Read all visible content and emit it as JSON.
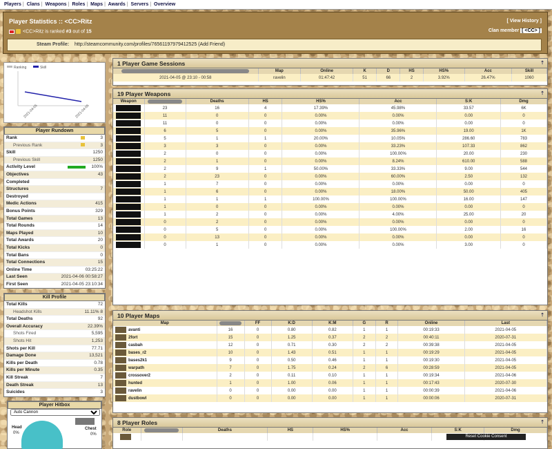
{
  "nav": [
    "Players",
    "Clans",
    "Weapons",
    "Roles",
    "Maps",
    "Awards",
    "Servers",
    "Overview"
  ],
  "header": {
    "title": "Player Statistics :: <CC>Ritz",
    "subtitle_name": "<CC>Ritz is ranked",
    "rank_num": "#3",
    "rank_of": "out of",
    "rank_total": "15",
    "view_history": "[ View History ]",
    "clan_label": "Clan member",
    "clan_tag": "[ <CC> ]",
    "steam_label": "Steam Profile:",
    "steam_url": "http://steamcommunity.com/profiles/76561197979412525 (Add Friend)"
  },
  "graph": {
    "legend": [
      "Ranking",
      "Skill"
    ],
    "dates": [
      "2021-04-05",
      "2021-04-06"
    ]
  },
  "rundown": {
    "title": "Player Rundown",
    "rows": [
      {
        "k": "Rank",
        "v": "3",
        "sub": false,
        "icon": true
      },
      {
        "k": "Previous Rank",
        "v": "3",
        "sub": true,
        "icon": true
      },
      {
        "k": "Skill",
        "v": "1250",
        "sub": false
      },
      {
        "k": "Previous Skill",
        "v": "1250",
        "sub": true
      },
      {
        "k": "Activity Level",
        "v": "100%",
        "sub": false,
        "bar": true
      },
      {
        "k": "Objectives",
        "v": "43",
        "sub": false
      },
      {
        "k": "Completed",
        "v": "",
        "sub": false
      },
      {
        "k": "Structures",
        "v": "7",
        "sub": false
      },
      {
        "k": "Destroyed",
        "v": "",
        "sub": false
      },
      {
        "k": "Medic Actions",
        "v": "415",
        "sub": false
      },
      {
        "k": "Bonus Points",
        "v": "329",
        "sub": false
      },
      {
        "k": "Total Games",
        "v": "13",
        "sub": false
      },
      {
        "k": "Total Rounds",
        "v": "14",
        "sub": false
      },
      {
        "k": "Maps Played",
        "v": "10",
        "sub": false
      },
      {
        "k": "Total Awards",
        "v": "20",
        "sub": false
      },
      {
        "k": "Total Kicks",
        "v": "0",
        "sub": false
      },
      {
        "k": "Total Bans",
        "v": "0",
        "sub": false
      },
      {
        "k": "Total Connections",
        "v": "15",
        "sub": false
      },
      {
        "k": "Online Time",
        "v": "03:25:22",
        "sub": false
      },
      {
        "k": "Last Seen",
        "v": "2021-04-06 00:58:27",
        "sub": false
      },
      {
        "k": "First Seen",
        "v": "2021-04-05 23:10:34",
        "sub": false
      }
    ]
  },
  "killprofile": {
    "title": "Kill Profile",
    "rows": [
      {
        "k": "Total Kills",
        "v": "72",
        "sub": false
      },
      {
        "k": "Headshot Kills",
        "v": "11.11%  8",
        "sub": true
      },
      {
        "k": "Total Deaths",
        "v": "92",
        "sub": false
      },
      {
        "k": "Overall Accuracy",
        "v": "22.39%",
        "sub": false
      },
      {
        "k": "Shots Fired",
        "v": "5,595",
        "sub": true
      },
      {
        "k": "Shots Hit",
        "v": "1,253",
        "sub": true
      },
      {
        "k": "Shots per Kill",
        "v": "77.71",
        "sub": false
      },
      {
        "k": "Damage Done",
        "v": "13,521",
        "sub": false
      },
      {
        "k": "Kills per Death",
        "v": "0.78",
        "sub": false
      },
      {
        "k": "Kills per Minute",
        "v": "0.35",
        "sub": false
      },
      {
        "k": "Kill Streak",
        "v": "7",
        "sub": false
      },
      {
        "k": "Death Streak",
        "v": "13",
        "sub": false
      },
      {
        "k": "Suicides",
        "v": "3",
        "sub": false
      }
    ]
  },
  "hitbox": {
    "title": "Player Hitbox",
    "select": "Auto Cannon",
    "head_label": "Head",
    "head_val": "0%",
    "chest_label": "Chest",
    "chest_val": "0%"
  },
  "sessions": {
    "title": "1 Player Game Sessions",
    "headers": [
      "Map",
      "Online",
      "K",
      "D",
      "HS",
      "HS%",
      "Acc",
      "Skill"
    ],
    "rows": [
      [
        "2021-04-05 @ 23:10 - 00:58",
        "ravelin",
        "01:47:42",
        "51",
        "66",
        "2",
        "3.92%",
        "26.47%",
        "1060"
      ]
    ]
  },
  "weapons": {
    "title": "19 Player Weapons",
    "headers": [
      "Weapon",
      "Deaths",
      "HS",
      "HS%",
      "Acc",
      "S:K",
      "Dmg"
    ],
    "rows": [
      [
        "23",
        "16",
        "4",
        "17.39%",
        "45.98%",
        "33.57",
        "6K"
      ],
      [
        "11",
        "0",
        "0",
        "0.00%",
        "0.00%",
        "0.00",
        "0"
      ],
      [
        "11",
        "0",
        "0",
        "0.00%",
        "0.00%",
        "0.00",
        "0"
      ],
      [
        "6",
        "5",
        "0",
        "0.00%",
        "35.96%",
        "19.00",
        "1K"
      ],
      [
        "5",
        "1",
        "1",
        "20.00%",
        "10.05%",
        "286.60",
        "783"
      ],
      [
        "3",
        "3",
        "0",
        "0.00%",
        "33.23%",
        "107.33",
        "862"
      ],
      [
        "2",
        "0",
        "0",
        "0.00%",
        "100.00%",
        "20.00",
        "230"
      ],
      [
        "2",
        "1",
        "0",
        "0.00%",
        "8.24%",
        "610.00",
        "588"
      ],
      [
        "2",
        "9",
        "1",
        "50.00%",
        "33.33%",
        "9.00",
        "544"
      ],
      [
        "2",
        "23",
        "0",
        "0.00%",
        "60.00%",
        "2.50",
        "132"
      ],
      [
        "1",
        "7",
        "0",
        "0.00%",
        "0.00%",
        "0.00",
        "0"
      ],
      [
        "1",
        "6",
        "0",
        "0.00%",
        "18.00%",
        "50.00",
        "405"
      ],
      [
        "1",
        "1",
        "1",
        "100.00%",
        "100.00%",
        "16.00",
        "147"
      ],
      [
        "1",
        "0",
        "0",
        "0.00%",
        "0.00%",
        "0.00",
        "0"
      ],
      [
        "1",
        "2",
        "0",
        "0.00%",
        "4.00%",
        "25.00",
        "20"
      ],
      [
        "0",
        "2",
        "0",
        "0.00%",
        "0.00%",
        "0.00",
        "0"
      ],
      [
        "0",
        "5",
        "0",
        "0.00%",
        "100.00%",
        "2.00",
        "16"
      ],
      [
        "0",
        "13",
        "0",
        "0.00%",
        "0.00%",
        "0.00",
        "0"
      ],
      [
        "0",
        "1",
        "0",
        "0.00%",
        "0.00%",
        "3.00",
        "0"
      ]
    ]
  },
  "maps": {
    "title": "10 Player Maps",
    "headers": [
      "Map",
      "FF",
      "K:D",
      "K:M",
      "G",
      "R",
      "Online",
      "Last"
    ],
    "rows": [
      [
        "avanti",
        "16",
        "0",
        "0.80",
        "0.82",
        "1",
        "1",
        "00:19:33",
        "2021-04-05"
      ],
      [
        "2fort",
        "15",
        "0",
        "1.25",
        "0.37",
        "2",
        "2",
        "00:40:11",
        "2020-07-31"
      ],
      [
        "casbah",
        "12",
        "0",
        "0.71",
        "0.30",
        "2",
        "2",
        "00:39:38",
        "2021-04-05"
      ],
      [
        "bases_r2",
        "10",
        "0",
        "1.43",
        "0.51",
        "1",
        "1",
        "00:19:29",
        "2021-04-05"
      ],
      [
        "bases2k1",
        "9",
        "0",
        "0.50",
        "0.46",
        "1",
        "1",
        "00:19:30",
        "2021-04-05"
      ],
      [
        "warpath",
        "7",
        "0",
        "1.75",
        "0.24",
        "2",
        "6",
        "00:28:59",
        "2021-04-05"
      ],
      [
        "crossover2",
        "2",
        "0",
        "0.11",
        "0.10",
        "1",
        "1",
        "00:19:34",
        "2021-04-06"
      ],
      [
        "hunted",
        "1",
        "0",
        "1.00",
        "0.06",
        "1",
        "1",
        "00:17:43",
        "2020-07-30"
      ],
      [
        "ravelin",
        "0",
        "0",
        "0.00",
        "0.00",
        "1",
        "1",
        "00:00:39",
        "2021-04-06"
      ],
      [
        "dustbowl",
        "0",
        "0",
        "0.00",
        "0.00",
        "1",
        "1",
        "00:00:06",
        "2020-07-31"
      ]
    ]
  },
  "roles": {
    "title": "8 Player Roles",
    "headers": [
      "Role",
      "Deaths",
      "HS",
      "HS%",
      "Acc",
      "S:K",
      "Dmg"
    ]
  },
  "reset_button": "Reset Cookie Consent"
}
